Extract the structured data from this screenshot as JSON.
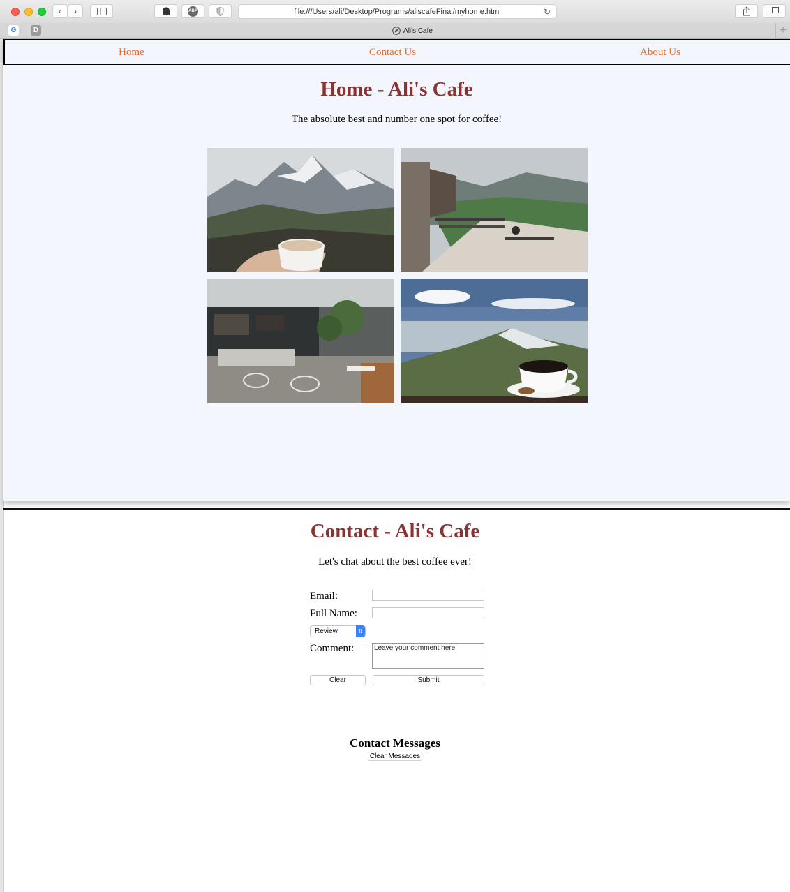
{
  "browser": {
    "url": "file:///Users/ali/Desktop/Programs/aliscafeFinal/myhome.html",
    "tab_title": "Ali's Cafe",
    "abp_label": "ABP",
    "favicon_g": "G",
    "favicon_d": "D"
  },
  "nav": {
    "items": [
      {
        "label": "Home"
      },
      {
        "label": "Contact Us"
      },
      {
        "label": "About Us"
      }
    ]
  },
  "home": {
    "title": "Home - Ali's Cafe",
    "tagline": "The absolute best and number one spot for coffee!",
    "photos": [
      {
        "name": "mountain-coffee-cup-photo"
      },
      {
        "name": "balcony-mountain-view-photo"
      },
      {
        "name": "cafe-interior-photo"
      },
      {
        "name": "coffee-over-valley-photo"
      }
    ]
  },
  "contact": {
    "title": "Contact - Ali's Cafe",
    "tagline": "Let's chat about the best coffee ever!",
    "email_label": "Email:",
    "fullname_label": "Full Name:",
    "select_value": "Review",
    "comment_label": "Comment:",
    "comment_placeholder": "Leave your comment here",
    "clear_label": "Clear",
    "submit_label": "Submit",
    "messages_title": "Contact Messages",
    "clear_messages_label": "Clear Messages"
  },
  "colors": {
    "heading": "#8b3232",
    "nav_link": "#e36b2c",
    "panel_bg": "#f3f6fc"
  }
}
